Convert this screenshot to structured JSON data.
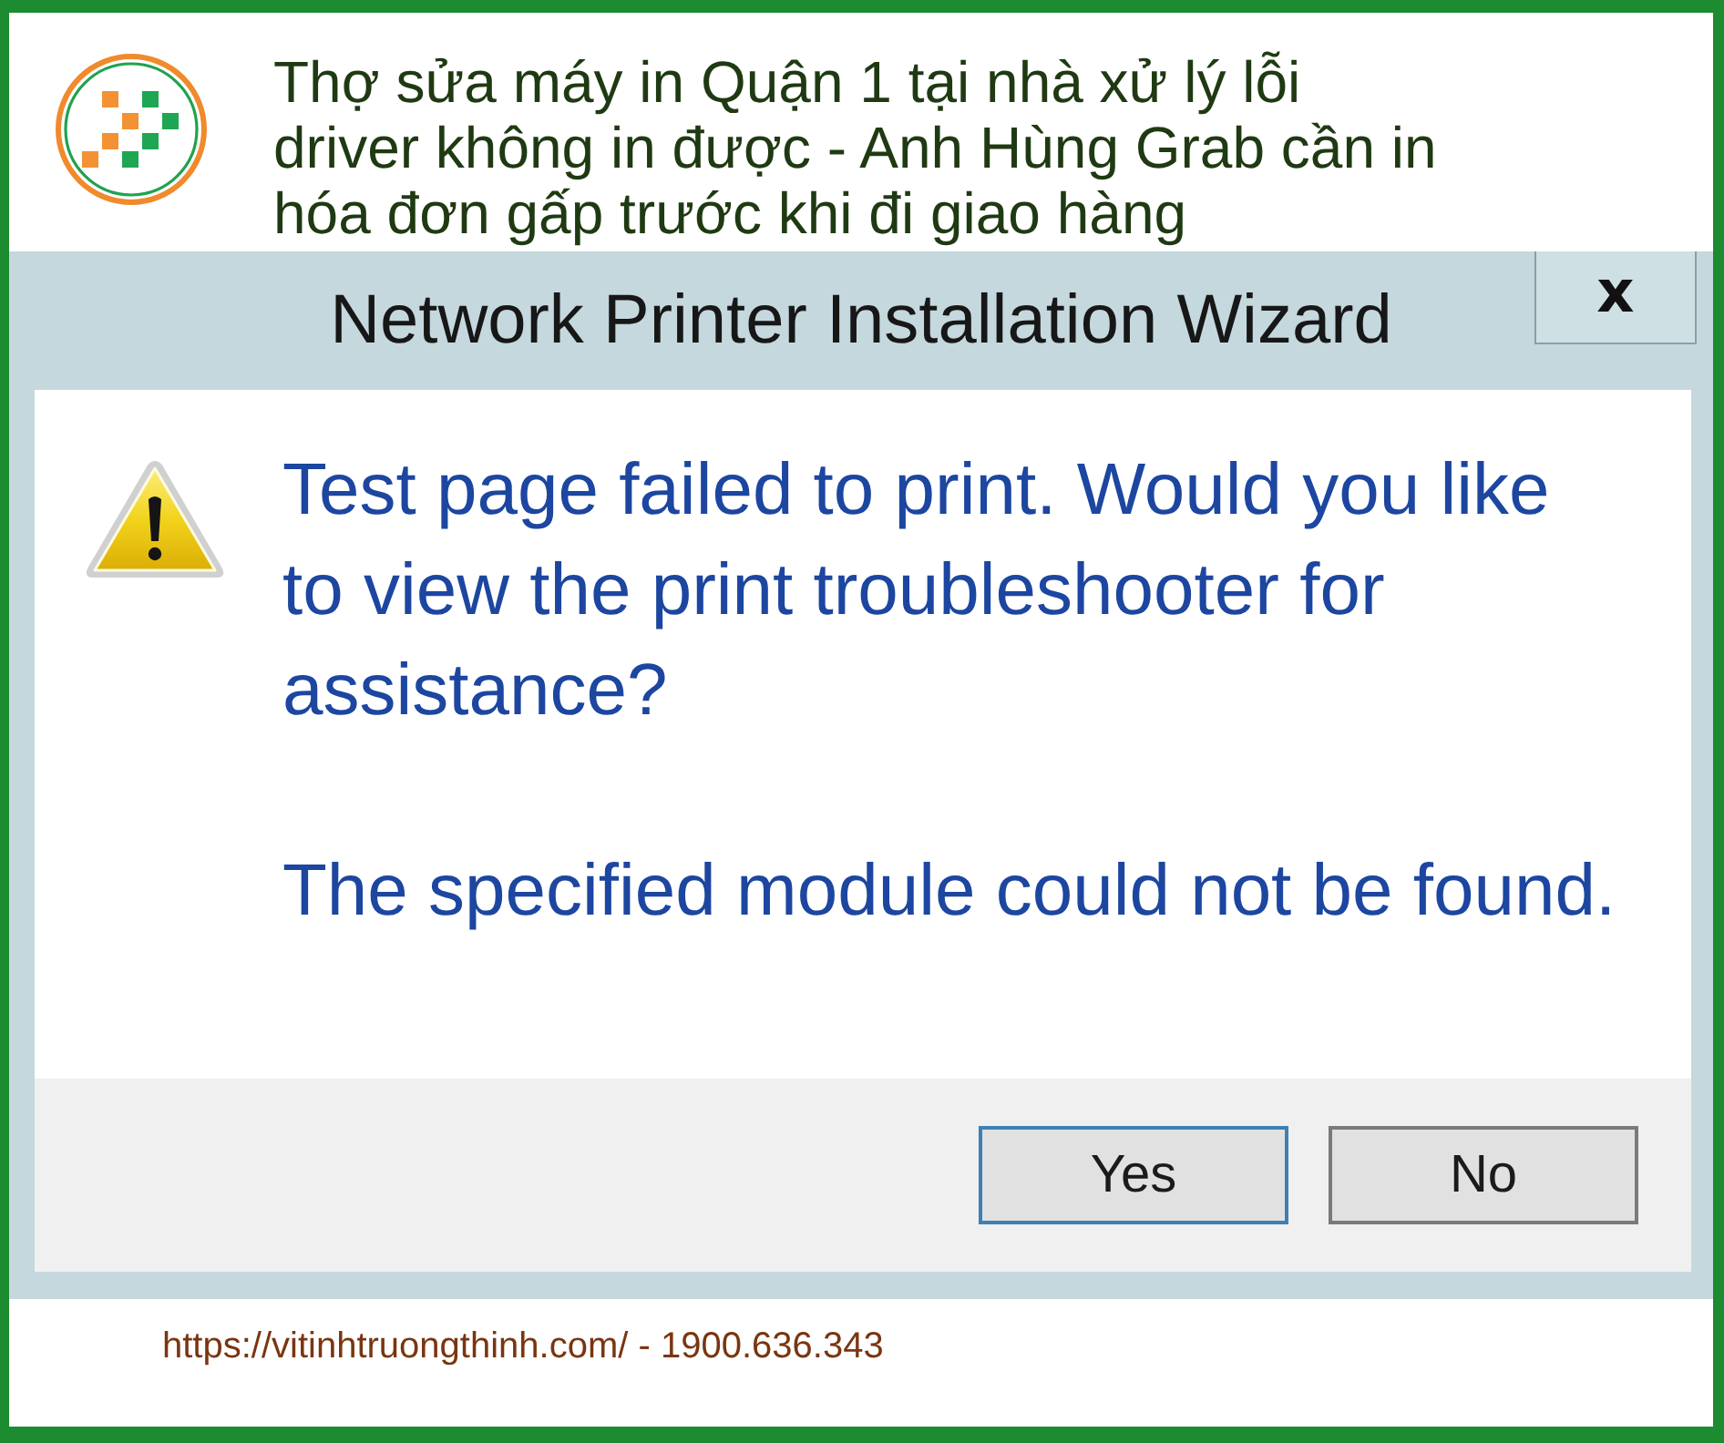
{
  "header": {
    "headline": "Thợ sửa máy in Quận 1 tại nhà xử lý lỗi\ndriver không in được - Anh Hùng Grab cần in\nhóa đơn gấp trước khi đi giao hàng"
  },
  "dialog": {
    "title": "Network Printer Installation Wizard",
    "close": "x",
    "messages": [
      "Test page failed to print. Would you like to view the print troubleshooter for assistance?",
      "The specified module could not be found."
    ],
    "buttons": [
      {
        "label": "Yes",
        "focused": true
      },
      {
        "label": "No",
        "focused": false
      }
    ]
  },
  "footer": {
    "text": "https://vitinhtruongthinh.com/ - 1900.636.343"
  }
}
